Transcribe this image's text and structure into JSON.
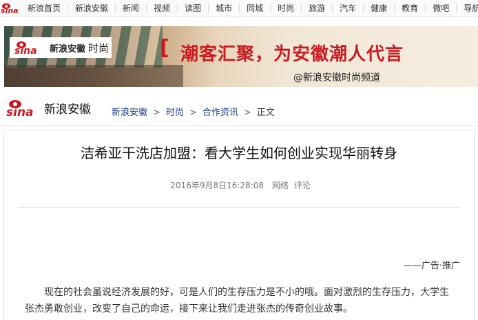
{
  "topnav": {
    "logo_text": "sina",
    "items": [
      "新浪首页",
      "新浪安徽",
      "新闻",
      "视频",
      "读图",
      "城市",
      "同城",
      "时尚",
      "旅游",
      "汽车",
      "健康",
      "教育",
      "微吧",
      "导航"
    ]
  },
  "banner": {
    "logo_text": "sina",
    "brand": "新浪安徽",
    "channel_name": "时尚",
    "bracket": "[",
    "slogan": "潮客汇聚，为安徽潮人代言",
    "channel_label": "@新浪安徽时尚频道"
  },
  "header": {
    "logo_text": "sina",
    "site_name": "新浪安徽",
    "breadcrumb": [
      "新浪安徽",
      "时尚",
      "合作资讯",
      "正文"
    ],
    "separator": ">"
  },
  "article": {
    "title": "洁希亚干洗店加盟：看大学生如何创业实现华丽转身",
    "datetime": "2016年9月8日16:28:08",
    "source": "网络",
    "comment_label": "评论",
    "ad_note": "——广告·推广",
    "first_paragraph": "现在的社会虽说经济发展的好，可是人们的生存压力是不小的哦。面对激烈的生存压力，大学生张杰勇敢创业，改变了自己的命运，接下来让我们走进张杰的传奇创业故事。"
  },
  "colors": {
    "brand_red": "#c91a22",
    "link_blue": "#1a3e8a"
  }
}
